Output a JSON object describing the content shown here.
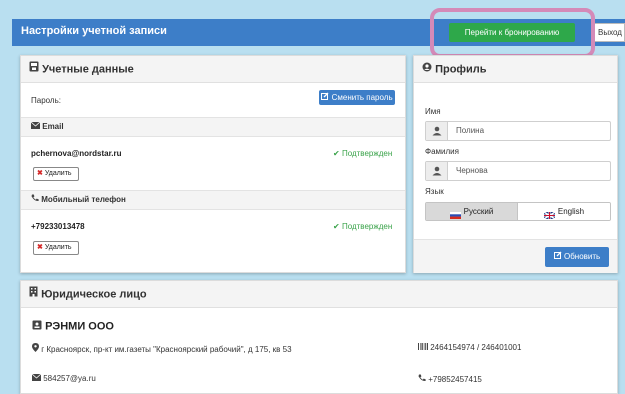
{
  "header": {
    "title": "Настройки учетной записи",
    "booking_button": "Перейти к бронированию",
    "exit_button": "Выход"
  },
  "account": {
    "title": "Учетные данные",
    "password_label": "Пароль:",
    "change_password_button": "Сменить пароль",
    "email_section": "Email",
    "email_value": "pchernova@nordstar.ru",
    "email_status": "Подтвержден",
    "delete_label": "Удалить",
    "phone_section": "Мобильный телефон",
    "phone_value": "+79233013478",
    "phone_status": "Подтвержден"
  },
  "profile": {
    "title": "Профиль",
    "first_name_label": "Имя",
    "first_name_placeholder": "Полина",
    "last_name_label": "Фамилия",
    "last_name_placeholder": "Чернова",
    "language_label": "Язык",
    "languages": [
      "Русский",
      "English"
    ],
    "selected_language": "Русский",
    "update_button": "Обновить"
  },
  "legal": {
    "title": "Юридическое лицо",
    "company_name": "РЭНМИ ООО",
    "address": "г Красноярск, пр-кт им.газеты \"Красноярский рабочий\", д 175, кв 53",
    "inn_kpp": "2464154974 / 246401001",
    "email": "584257@ya.ru",
    "phone": "+79852457415"
  },
  "colors": {
    "header_blue": "#3d7ec8",
    "booking_green": "#2ea84a",
    "confirmed_green": "#3aa34a",
    "highlight_pink": "#d48ab8"
  }
}
